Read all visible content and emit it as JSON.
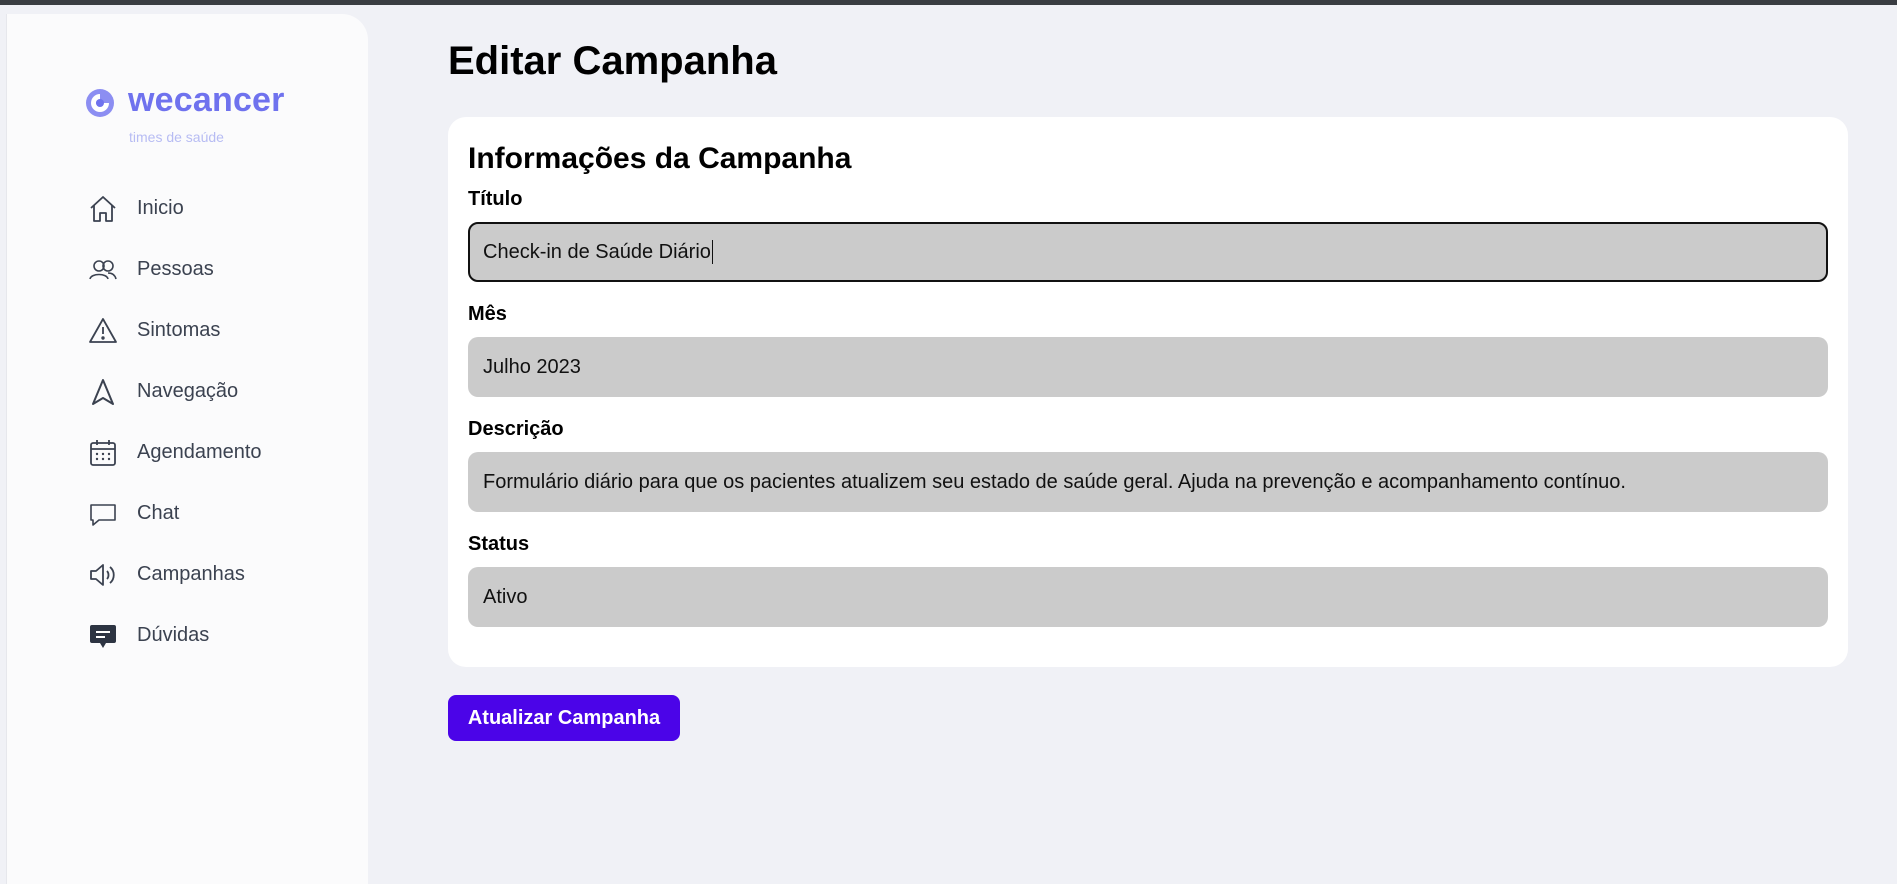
{
  "brand": {
    "name": "wecancer",
    "tagline": "times de saúde",
    "color": "#6f72ee"
  },
  "sidebar": {
    "items": [
      {
        "label": "Inicio",
        "icon": "home-icon"
      },
      {
        "label": "Pessoas",
        "icon": "people-icon"
      },
      {
        "label": "Sintomas",
        "icon": "warning-icon"
      },
      {
        "label": "Navegação",
        "icon": "navigation-arrow-icon"
      },
      {
        "label": "Agendamento",
        "icon": "calendar-icon"
      },
      {
        "label": "Chat",
        "icon": "chat-bubble-icon"
      },
      {
        "label": "Campanhas",
        "icon": "megaphone-icon"
      },
      {
        "label": "Dúvidas",
        "icon": "question-message-icon"
      }
    ]
  },
  "page": {
    "title": "Editar Campanha"
  },
  "form": {
    "section_title": "Informações da Campanha",
    "titulo": {
      "label": "Título",
      "value": "Check-in de Saúde Diário"
    },
    "mes": {
      "label": "Mês",
      "value": "Julho 2023"
    },
    "descricao": {
      "label": "Descrição",
      "value": "Formulário diário para que os pacientes atualizem seu estado de saúde geral. Ajuda na prevenção e acompanhamento contínuo."
    },
    "status": {
      "label": "Status",
      "value": "Ativo"
    },
    "submit_label": "Atualizar Campanha"
  },
  "colors": {
    "accent": "#4b04e8",
    "background": "#f0f1f6",
    "input_bg": "#cbcbcb"
  }
}
